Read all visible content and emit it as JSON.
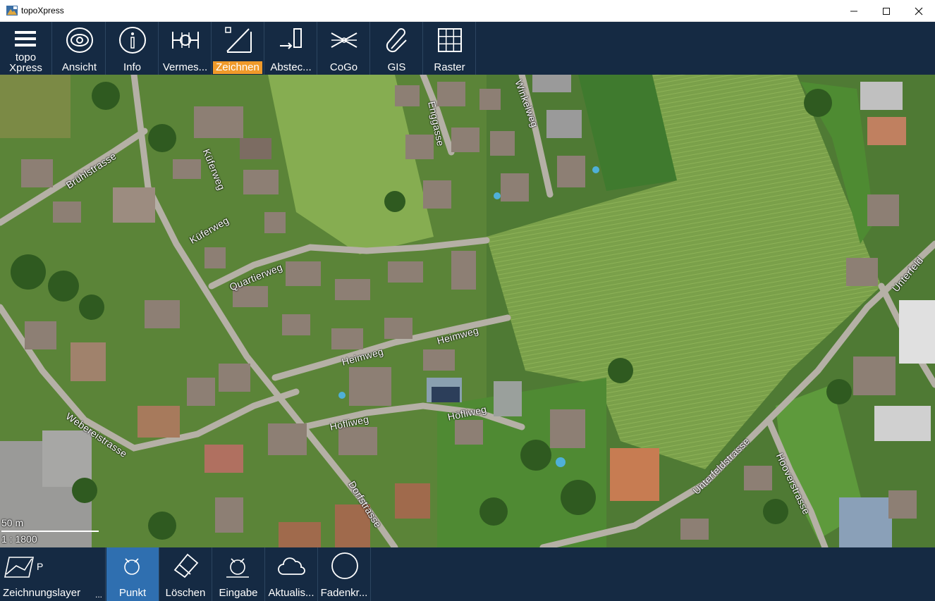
{
  "window": {
    "title": "topoXpress",
    "minimize_icon": "minimize-icon",
    "maximize_icon": "maximize-icon",
    "close_icon": "close-icon"
  },
  "toolbar": {
    "menu": {
      "label_line1": "topo",
      "label_line2": "Xpress",
      "icon": "hamburger-menu-icon"
    },
    "items": [
      {
        "label": "Ansicht",
        "icon": "eye-icon"
      },
      {
        "label": "Info",
        "icon": "info-icon"
      },
      {
        "label": "Vermes...",
        "icon": "survey-icon"
      },
      {
        "label": "Zeichnen",
        "icon": "draw-icon",
        "active": true
      },
      {
        "label": "Abstec...",
        "icon": "stakeout-icon"
      },
      {
        "label": "CoGo",
        "icon": "cogo-icon"
      },
      {
        "label": "GIS",
        "icon": "paperclip-icon"
      },
      {
        "label": "Raster",
        "icon": "grid-icon"
      }
    ],
    "active_color": "#f09a2a"
  },
  "map": {
    "streets": [
      "Brühlstrasse",
      "Küferweg",
      "Küferweg",
      "Quartierweg",
      "Enggasse",
      "Winkelweg",
      "Heimweg",
      "Heimweg",
      "Höfliweg",
      "Höfliweg",
      "Webereistrasse",
      "Dorfstrasse",
      "Unterfeldstrasse",
      "Hooverstrasse",
      "Unterfeld"
    ],
    "scale_distance": "50 m",
    "scale_ratio": "1 : 1800"
  },
  "bottombar": {
    "layer": {
      "tag": "P",
      "label": "Zeichnungslayer",
      "more": "...",
      "icon": "layer-icon"
    },
    "items": [
      {
        "label": "Punkt",
        "icon": "point-icon",
        "active": true
      },
      {
        "label": "Löschen",
        "icon": "eraser-icon"
      },
      {
        "label": "Eingabe",
        "icon": "point-input-icon"
      },
      {
        "label": "Aktualis...",
        "icon": "cloud-icon"
      },
      {
        "label": "Fadenkr...",
        "icon": "circle-icon"
      }
    ]
  },
  "colors": {
    "bar_bg": "#152a43",
    "selected_bg": "#2f6fb0"
  }
}
